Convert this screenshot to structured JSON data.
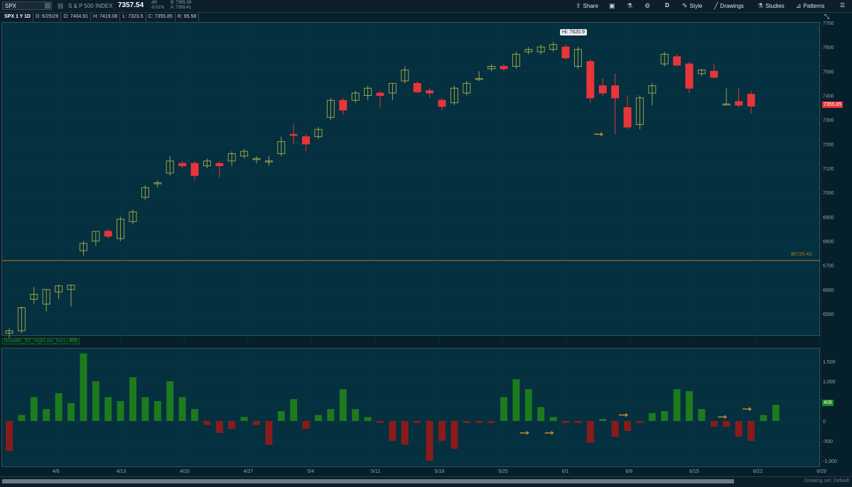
{
  "toolbar": {
    "symbol": "SPX",
    "name": "S & P 500 INDEX",
    "last": "7357.54",
    "change": "-68",
    "change_pct": "-0.01%",
    "bid": "B: 7355.39",
    "ask": "A: 7359.41",
    "share": "Share",
    "period": "D",
    "style": "Style",
    "drawings": "Drawings",
    "studies": "Studies",
    "patterns": "Patterns"
  },
  "info": {
    "symbol_label": "SPX 1 Y 1D",
    "date": "D: 6/25/26",
    "open": "O: 7404.91",
    "high": "H: 7419.08",
    "low": "L: 7323.5",
    "close": "C: 7355.85",
    "range": "R: 95.58"
  },
  "price_panel": {
    "hi_label": "Hi: 7620.9",
    "last_price_tag": "7355.85",
    "level_label": "$6720.43",
    "y_ticks": [
      "7700",
      "7600",
      "7500",
      "7400",
      "7300",
      "7200",
      "7100",
      "7000",
      "6900",
      "6800",
      "6700",
      "6600",
      "6500"
    ]
  },
  "study": {
    "name": "Breadth_5D_HighLow_Net",
    "value": "409",
    "y_ticks": [
      "1,500",
      "1,000",
      "500",
      "0",
      "-500",
      "-1,000"
    ]
  },
  "x_ticks": [
    "4/6",
    "4/13",
    "4/20",
    "4/27",
    "5/4",
    "5/11",
    "5/18",
    "5/25",
    "6/1",
    "6/8",
    "6/15",
    "6/22",
    "6/29"
  ],
  "bottom": {
    "drawing_set": "Drawing set: Default"
  },
  "colors": {
    "up": "#9aa34a",
    "down": "#e8353a",
    "hist_pos": "#1d7a1d",
    "hist_neg": "#8a1b1b",
    "bg": "#04303f"
  },
  "chart_data": {
    "type": "candlestick",
    "y_range": [
      6450,
      7710
    ],
    "candles": [
      {
        "o": 6420,
        "h": 6440,
        "l": 6400,
        "c": 6430
      },
      {
        "o": 6430,
        "h": 6530,
        "l": 6420,
        "c": 6525
      },
      {
        "o": 6560,
        "h": 6610,
        "l": 6540,
        "c": 6580
      },
      {
        "o": 6540,
        "h": 6600,
        "l": 6510,
        "c": 6600
      },
      {
        "o": 6590,
        "h": 6620,
        "l": 6560,
        "c": 6615
      },
      {
        "o": 6600,
        "h": 6620,
        "l": 6530,
        "c": 6618
      },
      {
        "o": 6760,
        "h": 6800,
        "l": 6740,
        "c": 6790
      },
      {
        "o": 6800,
        "h": 6840,
        "l": 6780,
        "c": 6840
      },
      {
        "o": 6840,
        "h": 6850,
        "l": 6810,
        "c": 6820
      },
      {
        "o": 6810,
        "h": 6900,
        "l": 6800,
        "c": 6890
      },
      {
        "o": 6880,
        "h": 6930,
        "l": 6870,
        "c": 6920
      },
      {
        "o": 6980,
        "h": 7030,
        "l": 6970,
        "c": 7020
      },
      {
        "o": 7040,
        "h": 7050,
        "l": 7020,
        "c": 7040
      },
      {
        "o": 7080,
        "h": 7150,
        "l": 7070,
        "c": 7130
      },
      {
        "o": 7120,
        "h": 7130,
        "l": 7100,
        "c": 7110
      },
      {
        "o": 7120,
        "h": 7130,
        "l": 7050,
        "c": 7070
      },
      {
        "o": 7110,
        "h": 7140,
        "l": 7100,
        "c": 7130
      },
      {
        "o": 7120,
        "h": 7130,
        "l": 7060,
        "c": 7110
      },
      {
        "o": 7130,
        "h": 7170,
        "l": 7110,
        "c": 7160
      },
      {
        "o": 7150,
        "h": 7180,
        "l": 7140,
        "c": 7170
      },
      {
        "o": 7140,
        "h": 7150,
        "l": 7120,
        "c": 7140
      },
      {
        "o": 7130,
        "h": 7150,
        "l": 7110,
        "c": 7130
      },
      {
        "o": 7160,
        "h": 7230,
        "l": 7150,
        "c": 7210
      },
      {
        "o": 7240,
        "h": 7280,
        "l": 7200,
        "c": 7235
      },
      {
        "o": 7230,
        "h": 7240,
        "l": 7170,
        "c": 7200
      },
      {
        "o": 7230,
        "h": 7270,
        "l": 7220,
        "c": 7260
      },
      {
        "o": 7310,
        "h": 7390,
        "l": 7300,
        "c": 7380
      },
      {
        "o": 7380,
        "h": 7390,
        "l": 7320,
        "c": 7340
      },
      {
        "o": 7380,
        "h": 7420,
        "l": 7370,
        "c": 7410
      },
      {
        "o": 7400,
        "h": 7440,
        "l": 7380,
        "c": 7430
      },
      {
        "o": 7410,
        "h": 7420,
        "l": 7350,
        "c": 7400
      },
      {
        "o": 7410,
        "h": 7450,
        "l": 7380,
        "c": 7450
      },
      {
        "o": 7460,
        "h": 7520,
        "l": 7450,
        "c": 7505
      },
      {
        "o": 7450,
        "h": 7460,
        "l": 7410,
        "c": 7415
      },
      {
        "o": 7420,
        "h": 7430,
        "l": 7390,
        "c": 7410
      },
      {
        "o": 7380,
        "h": 7390,
        "l": 7340,
        "c": 7355
      },
      {
        "o": 7370,
        "h": 7440,
        "l": 7360,
        "c": 7430
      },
      {
        "o": 7410,
        "h": 7460,
        "l": 7400,
        "c": 7450
      },
      {
        "o": 7470,
        "h": 7500,
        "l": 7460,
        "c": 7470
      },
      {
        "o": 7510,
        "h": 7530,
        "l": 7500,
        "c": 7520
      },
      {
        "o": 7520,
        "h": 7530,
        "l": 7500,
        "c": 7510
      },
      {
        "o": 7520,
        "h": 7580,
        "l": 7510,
        "c": 7570
      },
      {
        "o": 7580,
        "h": 7600,
        "l": 7570,
        "c": 7590
      },
      {
        "o": 7580,
        "h": 7610,
        "l": 7570,
        "c": 7600
      },
      {
        "o": 7590,
        "h": 7620,
        "l": 7580,
        "c": 7610
      },
      {
        "o": 7600,
        "h": 7610,
        "l": 7550,
        "c": 7555
      },
      {
        "o": 7520,
        "h": 7600,
        "l": 7510,
        "c": 7590
      },
      {
        "o": 7540,
        "h": 7550,
        "l": 7370,
        "c": 7390
      },
      {
        "o": 7440,
        "h": 7470,
        "l": 7400,
        "c": 7410
      },
      {
        "o": 7440,
        "h": 7490,
        "l": 7240,
        "c": 7390
      },
      {
        "o": 7350,
        "h": 7400,
        "l": 7260,
        "c": 7270
      },
      {
        "o": 7280,
        "h": 7400,
        "l": 7260,
        "c": 7390
      },
      {
        "o": 7410,
        "h": 7450,
        "l": 7360,
        "c": 7440
      },
      {
        "o": 7530,
        "h": 7580,
        "l": 7520,
        "c": 7570
      },
      {
        "o": 7560,
        "h": 7570,
        "l": 7520,
        "c": 7525
      },
      {
        "o": 7530,
        "h": 7540,
        "l": 7410,
        "c": 7430
      },
      {
        "o": 7490,
        "h": 7510,
        "l": 7480,
        "c": 7505
      },
      {
        "o": 7500,
        "h": 7530,
        "l": 7470,
        "c": 7475
      },
      {
        "o": 7365,
        "h": 7430,
        "l": 7360,
        "c": 7365
      },
      {
        "o": 7375,
        "h": 7430,
        "l": 7350,
        "c": 7360
      },
      {
        "o": 7405,
        "h": 7420,
        "l": 7325,
        "c": 7356
      }
    ],
    "histogram": [
      -750,
      150,
      600,
      300,
      700,
      450,
      1700,
      1000,
      600,
      500,
      1100,
      600,
      500,
      1000,
      600,
      300,
      -100,
      -300,
      -200,
      100,
      -100,
      -600,
      250,
      550,
      -200,
      150,
      300,
      800,
      300,
      100,
      -50,
      -500,
      -600,
      -50,
      -1000,
      -500,
      -700,
      -50,
      -50,
      -50,
      600,
      1050,
      800,
      350,
      100,
      -50,
      -50,
      -550,
      50,
      -400,
      -250,
      -50,
      200,
      250,
      800,
      750,
      300,
      -150,
      -150,
      -400,
      -500,
      150,
      409
    ],
    "arrows_price": [
      {
        "index": 48,
        "value": 7240
      }
    ],
    "arrows_hist": [
      {
        "index": 42,
        "value": -300
      },
      {
        "index": 44,
        "value": -300
      },
      {
        "index": 50,
        "value": 150
      },
      {
        "index": 58,
        "value": 100
      },
      {
        "index": 60,
        "value": 300
      }
    ]
  }
}
